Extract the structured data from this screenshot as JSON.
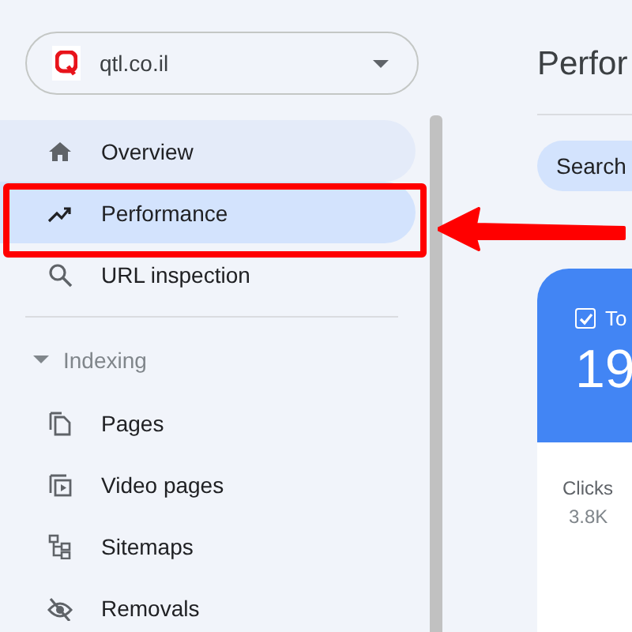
{
  "property": {
    "name": "qtl.co.il"
  },
  "nav": [
    {
      "kind": "item",
      "label": "Overview",
      "selected": false,
      "highlighted": true
    },
    {
      "kind": "item",
      "label": "Performance",
      "selected": true,
      "highlighted": false
    },
    {
      "kind": "item",
      "label": "URL inspection",
      "selected": false,
      "highlighted": false
    },
    {
      "kind": "divider"
    },
    {
      "kind": "section",
      "label": "Indexing",
      "expanded": true
    },
    {
      "kind": "item",
      "label": "Pages",
      "selected": false,
      "highlighted": false
    },
    {
      "kind": "item",
      "label": "Video pages",
      "selected": false,
      "highlighted": false
    },
    {
      "kind": "item",
      "label": "Sitemaps",
      "selected": false,
      "highlighted": false
    },
    {
      "kind": "item",
      "label": "Removals",
      "selected": false,
      "highlighted": false
    }
  ],
  "main": {
    "title": "Perfor",
    "chip": "Search",
    "metric_card": {
      "checked": true,
      "label": "To",
      "value": "19"
    },
    "metric": {
      "label": "Clicks",
      "value": "3.8K"
    }
  }
}
